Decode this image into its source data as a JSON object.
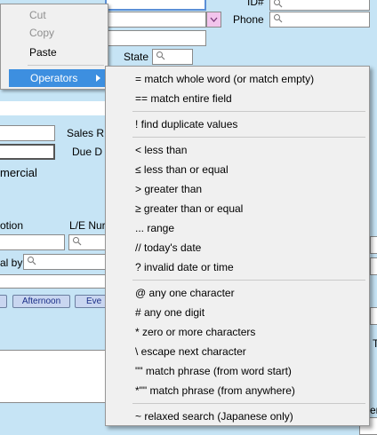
{
  "form": {
    "id_label": "ID#",
    "phone_label": "Phone",
    "state_label": "State",
    "sales_label": "Sales R",
    "due_label": "Due D",
    "commercial_text": "mercial",
    "option_label": "otion",
    "le_num_label": "L/E Nur",
    "by_label": "al by",
    "afternoon_button": "Afternoon",
    "eve_button": "Eve",
    "t_label": "T",
    "er_label": "er"
  },
  "context_menu": {
    "items": [
      {
        "label": "Cut",
        "enabled": false
      },
      {
        "label": "Copy",
        "enabled": false
      },
      {
        "label": "Paste",
        "enabled": true
      },
      {
        "label": "Operators",
        "enabled": true,
        "highlighted": true
      }
    ]
  },
  "operators_menu": {
    "groups": [
      [
        {
          "label": "=  match whole word (or match empty)"
        },
        {
          "label": "==  match entire field"
        }
      ],
      [
        {
          "label": "!  find duplicate values"
        }
      ],
      [
        {
          "label": "<   less than"
        },
        {
          "label": "≤  less than or equal"
        },
        {
          "label": ">   greater than"
        },
        {
          "label": "≥  greater than or equal"
        },
        {
          "label": "... range"
        },
        {
          "label": "//  today's date"
        },
        {
          "label": "?  invalid date or time"
        }
      ],
      [
        {
          "label": "@   any one character"
        },
        {
          "label": "#   any one digit"
        },
        {
          "label": "*   zero or more characters"
        },
        {
          "label": "\\   escape next character"
        },
        {
          "label": "\"\"  match phrase (from word start)"
        },
        {
          "label": "*\"\"  match phrase (from anywhere)"
        }
      ],
      [
        {
          "label": "~   relaxed search (Japanese only)"
        }
      ]
    ]
  },
  "colors": {
    "background": "#c6e4f5",
    "menu_bg": "#f0f0f0",
    "highlight": "#3d8fe0",
    "dropdown_pink": "#f2c4ec"
  }
}
